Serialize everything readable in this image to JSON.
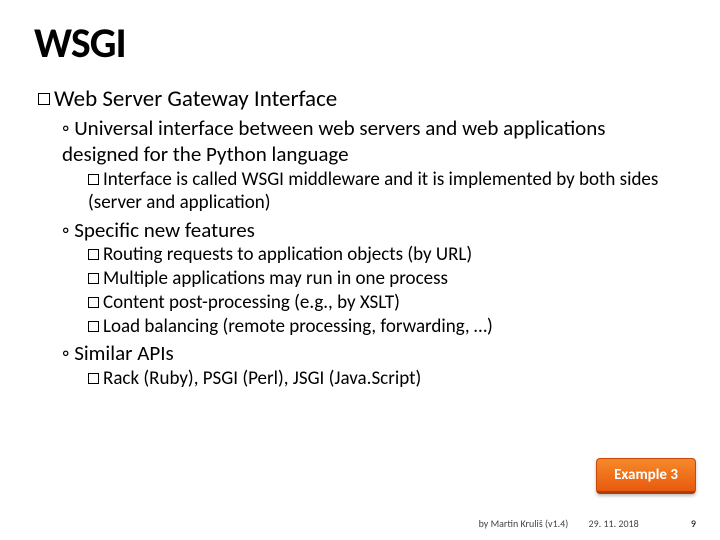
{
  "title": "WSGI",
  "heading": "Web Server Gateway Interface",
  "bullets": {
    "b1": "Universal interface between web servers and web applications designed for the Python language",
    "b1_1": "Interface is called WSGI middleware and it is implemented by both sides (server and application)",
    "b2": "Specific new features",
    "b2_1": "Routing requests to application objects (by URL)",
    "b2_2": "Multiple applications may run in one process",
    "b2_3": "Content post-processing (e.g., by XSLT)",
    "b2_4": "Load balancing (remote processing, forwarding, …)",
    "b3": "Similar APIs",
    "b3_1": "Rack (Ruby), PSGI (Perl), JSGI (Java.Script)"
  },
  "badge": "Example 3",
  "footer": {
    "author": "by Martin Kruliš (v1.4)",
    "date": "29. 11. 2018",
    "page": "9"
  }
}
